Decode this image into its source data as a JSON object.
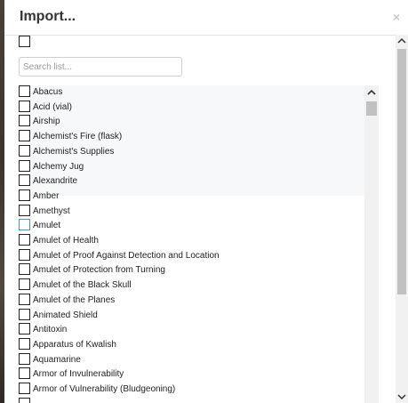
{
  "dialog": {
    "title": "Import...",
    "close_label": "×"
  },
  "search": {
    "placeholder": "Search list..."
  },
  "items": [
    {
      "label": "Abacus",
      "checked": false
    },
    {
      "label": "Acid (vial)",
      "checked": false
    },
    {
      "label": "Airship",
      "checked": false
    },
    {
      "label": "Alchemist's Fire (flask)",
      "checked": false
    },
    {
      "label": "Alchemist's Supplies",
      "checked": false
    },
    {
      "label": "Alchemy Jug",
      "checked": false
    },
    {
      "label": "Alexandrite",
      "checked": false
    },
    {
      "label": "Amber",
      "checked": false
    },
    {
      "label": "Amethyst",
      "checked": false
    },
    {
      "label": "Amulet",
      "checked": false
    },
    {
      "label": "Amulet of Health",
      "checked": false
    },
    {
      "label": "Amulet of Proof Against Detection and Location",
      "checked": false
    },
    {
      "label": "Amulet of Protection from Turning",
      "checked": false
    },
    {
      "label": "Amulet of the Black Skull",
      "checked": false
    },
    {
      "label": "Amulet of the Planes",
      "checked": false
    },
    {
      "label": "Animated Shield",
      "checked": false
    },
    {
      "label": "Antitoxin",
      "checked": false
    },
    {
      "label": "Apparatus of Kwalish",
      "checked": false
    },
    {
      "label": "Aquamarine",
      "checked": false
    },
    {
      "label": "Armor of Invulnerability",
      "checked": false
    },
    {
      "label": "Armor of Vulnerability (Bludgeoning)",
      "checked": false
    },
    {
      "label": "",
      "checked": false
    }
  ],
  "icons": {
    "scroll_up": "▲",
    "scroll_down": "▼"
  }
}
